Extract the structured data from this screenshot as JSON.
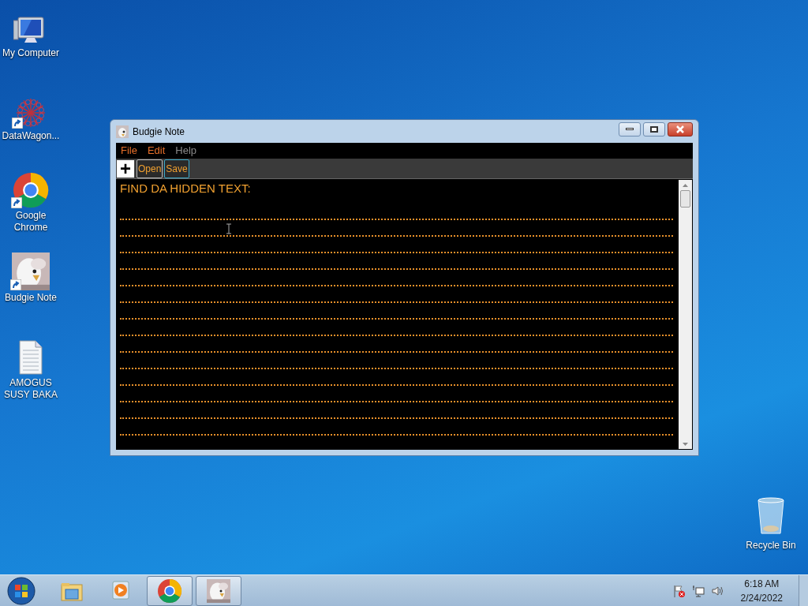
{
  "desktop_icons": [
    {
      "kind": "computer",
      "label": "My Computer",
      "shortcut": false
    },
    {
      "kind": "web",
      "label": "DataWagon...",
      "shortcut": true
    },
    {
      "kind": "chrome",
      "label": "Google Chrome",
      "shortcut": true
    },
    {
      "kind": "picture",
      "label": "Budgie Note",
      "shortcut": true
    },
    {
      "kind": "document",
      "label": "AMOGUS SUSY BAKA",
      "shortcut": false
    }
  ],
  "recycle_bin": {
    "label": "Recycle Bin"
  },
  "window": {
    "title": "Budgie Note",
    "menu": [
      {
        "label": "File",
        "disabled": false
      },
      {
        "label": "Edit",
        "disabled": false
      },
      {
        "label": "Help",
        "disabled": true
      }
    ],
    "toolbar": [
      {
        "kind": "new",
        "label": "+"
      },
      {
        "kind": "open",
        "label": "Open"
      },
      {
        "kind": "save",
        "label": "Save"
      }
    ],
    "editor": {
      "text": "FIND DA HIDDEN TEXT:"
    }
  },
  "taskbar": {
    "apps": [
      {
        "kind": "explorer",
        "running": false
      },
      {
        "kind": "media",
        "running": false
      },
      {
        "kind": "chrome",
        "running": true
      },
      {
        "kind": "picture",
        "running": true
      }
    ],
    "clock": {
      "time": "6:18 AM",
      "date": "2/24/2022"
    }
  }
}
